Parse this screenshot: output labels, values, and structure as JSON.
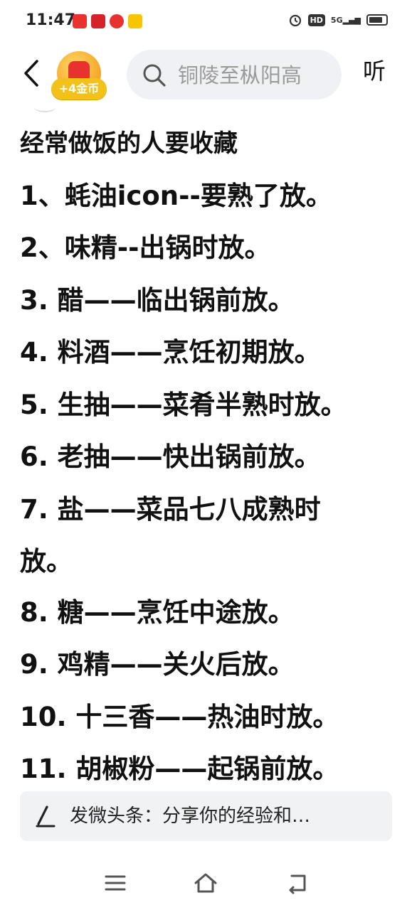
{
  "status_bar": {
    "time": "11:47",
    "network": "5G",
    "hd": "HD",
    "battery_level": 0.85
  },
  "header": {
    "coin_reward": "+4金币",
    "search_placeholder": "铜陵至枞阳高",
    "listen_label": "听"
  },
  "article": {
    "title": "经常做饭的人要收藏",
    "lines": [
      "1、蚝油icon--要熟了放。",
      "2、味精--出锅时放。",
      "3. 醋——临出锅前放。",
      "4. 料酒——烹饪初期放。",
      "5. 生抽——菜肴半熟时放。",
      "6. 老抽——快出锅前放。",
      "7. 盐——菜品七八成熟时",
      "放。",
      "8. 糖——烹饪中途放。",
      "9. 鸡精——关火后放。",
      "10. 十三香——热油时放。",
      "11. 胡椒粉——起锅前放。"
    ]
  },
  "comment_bar": {
    "prompt": "发微头条：分享你的经验和…"
  },
  "icons": {
    "back": "chevron-left-icon",
    "search": "search-icon",
    "pen": "pen-icon",
    "menu": "menu-icon",
    "home": "home-icon",
    "back_nav": "back-icon"
  }
}
